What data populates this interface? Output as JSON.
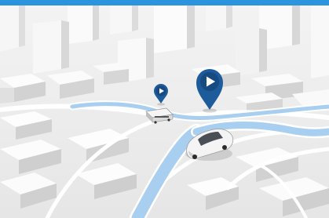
{
  "colors": {
    "top_bar": "#2a95dc",
    "ground": "#e9e9e9",
    "building_top": "#fbfbfb",
    "building_side": "#dcdcdc",
    "route_fill": "#a9cff0",
    "route_outline": "#ffffff",
    "pin": "#1e5b9b",
    "pin_dark": "#174a80",
    "car": "#f4f4f4"
  },
  "icons": {
    "pin_large": "play-icon",
    "pin_small": "play-icon",
    "vehicle_car": "car-icon",
    "vehicle_bus": "bus-icon"
  }
}
